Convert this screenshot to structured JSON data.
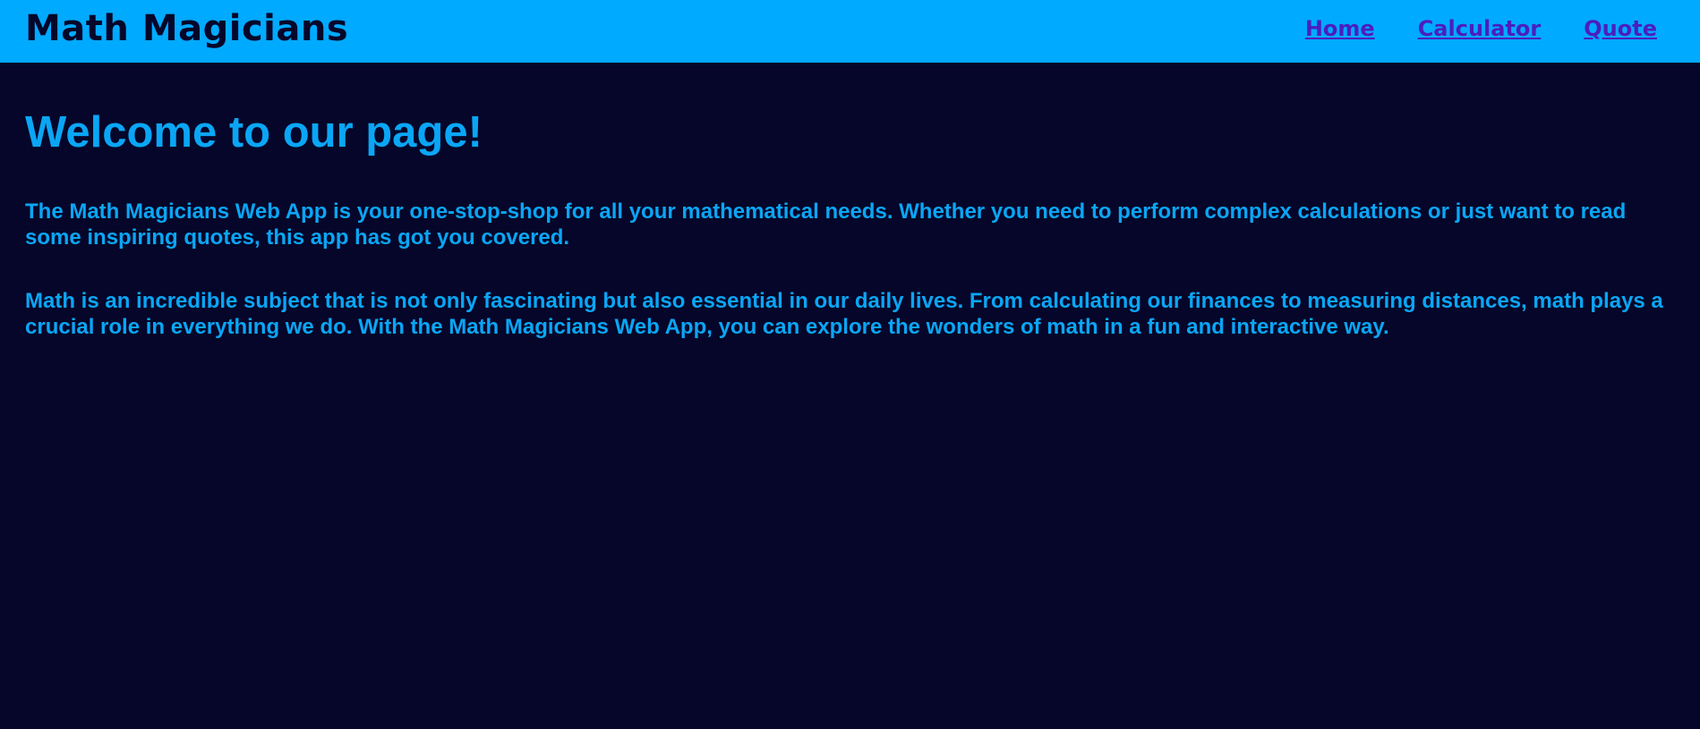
{
  "colors": {
    "header_bg": "#00aaff",
    "page_bg": "#050629",
    "brand_text": "#050629",
    "nav_link": "#4b1ec0",
    "body_text": "#0aa6f5"
  },
  "header": {
    "title": "Math Magicians",
    "nav": [
      {
        "label": "Home"
      },
      {
        "label": "Calculator"
      },
      {
        "label": "Quote"
      }
    ]
  },
  "main": {
    "heading": "Welcome to our page!",
    "paragraphs": [
      "The Math Magicians Web App is your one-stop-shop for all your mathematical needs. Whether you need to perform complex calculations or just want to read some inspiring quotes, this app has got you covered.",
      "Math is an incredible subject that is not only fascinating but also essential in our daily lives. From calculating our finances to measuring distances, math plays a crucial role in everything we do. With the Math Magicians Web App, you can explore the wonders of math in a fun and interactive way."
    ]
  }
}
